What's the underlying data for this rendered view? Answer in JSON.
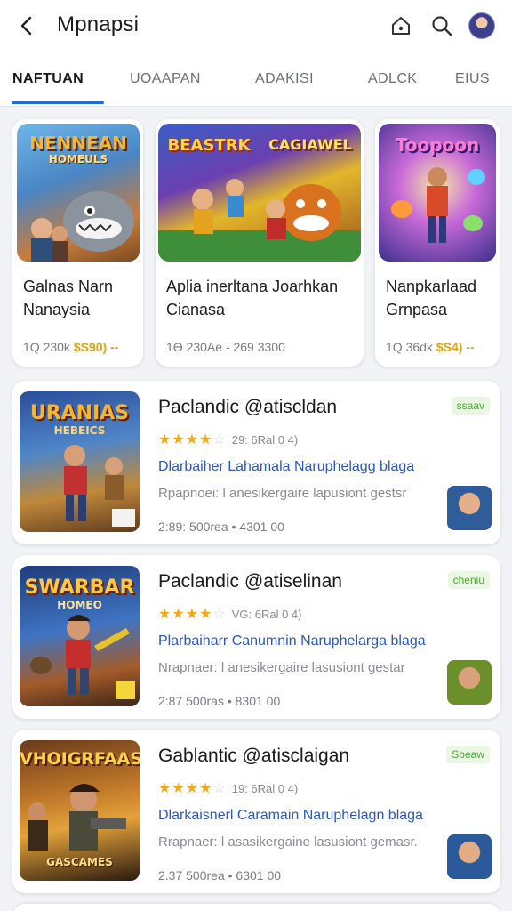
{
  "header": {
    "title": "Mpnapsi",
    "icons": [
      "back-arrow-icon",
      "home-icon",
      "search-icon",
      "profile-avatar"
    ]
  },
  "tabs": [
    {
      "label": "NAFTUAN",
      "active": true
    },
    {
      "label": "UOAAPAN",
      "active": false
    },
    {
      "label": "ADAKISI",
      "active": false
    },
    {
      "label": "ADLCK",
      "active": false
    },
    {
      "label": "EIUS",
      "active": false
    }
  ],
  "featured": [
    {
      "art_title": "NENNEAN",
      "art_subtitle": "HOMEULS",
      "name_line1": "Galnas Narn",
      "name_line2": "Nanaysia",
      "meta": "1Q 230k",
      "price": "$S90) --"
    },
    {
      "art_title_left": "BEASTRK",
      "art_title_right": "CAGIAWEL",
      "name_line1": "Aplia inerltana Joarhkan",
      "name_line2": "Cianasa",
      "meta": "1Ɵ 230Ae - 269 3300"
    },
    {
      "art_title": "Toopoon",
      "name_line1": "Nanpkarlaad",
      "name_line2": "Grnpasa",
      "meta": "1Q 36dk",
      "price": "$S4) --"
    }
  ],
  "list": [
    {
      "art_title": "URANIAS",
      "art_subtitle": "HEBEICS",
      "title": "Paclandic @atiscldan",
      "rating": 3.5,
      "rating_meta": "29: 6Ral 0 4)",
      "link": "Dlarbaiher Lahamala Naruphelagg blaga",
      "desc": "Rpapnoei: l anesikergaire lapusiont gestsr",
      "stats": "2:89: 500rea • 4301 00",
      "badge": "ssaav"
    },
    {
      "art_title": "SWARBAR",
      "art_subtitle": "HOMEO",
      "title": "Paclandic @atiselinan",
      "rating": 3.5,
      "rating_meta": "VG: 6Ral 0 4)",
      "link": "Plarbaiharr Canumnin Naruphelarga blaga",
      "desc": "Nrapnaer: l anesikergaire lasusiont gestar",
      "stats": "2:87 500ras • 8301 00",
      "badge": "cheniu"
    },
    {
      "art_title": "VHOIGRFAAS",
      "art_subtitle": "",
      "art_footer": "GASCAMES",
      "title": "Gablantic @atisclaigan",
      "rating": 3.5,
      "rating_meta": "19: 6Ral 0 4)",
      "link": "Dlarkaisnerl Caramain Naruphelagn blaga",
      "desc": "Rrapnaer: l asasikergaine lasusiont gemasr.",
      "stats": "2.37 500rea • 6301 00",
      "badge": "Sbeaw"
    }
  ],
  "colors": {
    "accent_tab": "#1f6fd6",
    "star": "#f0a81c",
    "price": "#e0a213",
    "link": "#2d58b8",
    "badge_text": "#4caa32",
    "badge_bg": "#eaf7e2"
  }
}
